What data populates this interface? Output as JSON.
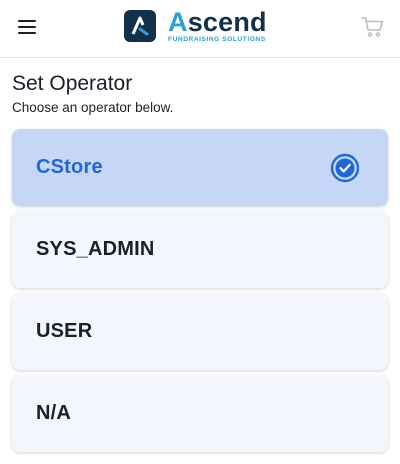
{
  "header": {
    "menu_icon": "hamburger-menu-icon",
    "logo": {
      "word_prefix": "A",
      "word_rest": "scend",
      "tagline": "FUNDRAISING SOLUTIONS"
    },
    "cart_icon": "shopping-cart-icon"
  },
  "page": {
    "title": "Set Operator",
    "subtitle": "Choose an operator below."
  },
  "operators": [
    {
      "label": "CStore",
      "selected": true
    },
    {
      "label": "SYS_ADMIN",
      "selected": false
    },
    {
      "label": "USER",
      "selected": false
    },
    {
      "label": "N/A",
      "selected": false
    }
  ],
  "colors": {
    "accent": "#1e68d7",
    "selected_bg": "#c6d6f7",
    "card_bg": "#f4f6fd",
    "brand_dark": "#13304b",
    "brand_light": "#2a9fd8"
  }
}
